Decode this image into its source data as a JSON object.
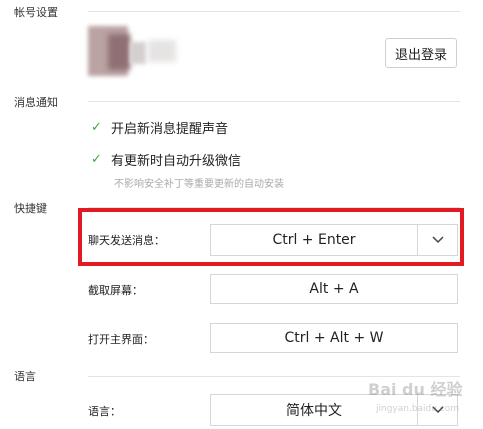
{
  "account": {
    "section_label": "帐号设置",
    "logout_label": "退出登录"
  },
  "notifications": {
    "section_label": "消息通知",
    "sound_label": "开启新消息提醒声音",
    "sound_checked": true,
    "auto_update_label": "有更新时自动升级微信",
    "auto_update_checked": true,
    "auto_update_hint": "不影响安全补丁等重要更新的自动安装",
    "check_glyph": "✓"
  },
  "shortcuts": {
    "section_label": "快捷键",
    "send_label": "聊天发送消息：",
    "send_value": "Ctrl + Enter",
    "capture_label": "截取屏幕：",
    "capture_value": "Alt + A",
    "open_label": "打开主界面：",
    "open_value": "Ctrl + Alt + W"
  },
  "language": {
    "section_label": "语言",
    "row_label": "语言：",
    "value": "简体中文"
  },
  "watermark": {
    "text": "Bai du 经验",
    "sub": "jingyan.baidu.com"
  },
  "colors": {
    "highlight": "#e21b22",
    "check": "#3fa33f"
  }
}
